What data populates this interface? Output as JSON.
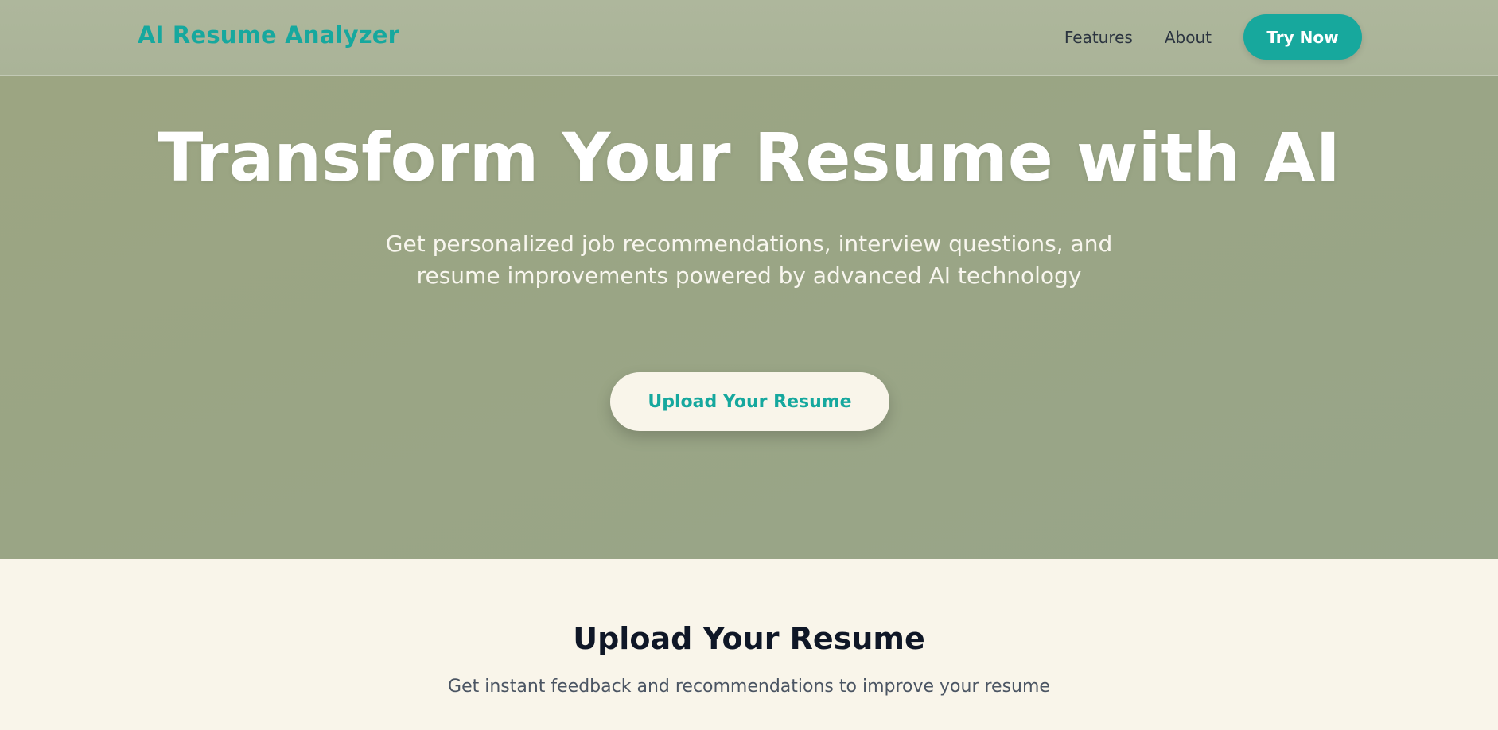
{
  "header": {
    "logo": "AI Resume Analyzer",
    "nav": {
      "features": "Features",
      "about": "About",
      "try_now": "Try Now"
    }
  },
  "hero": {
    "title": "Transform Your Resume with AI",
    "subtitle": "Get personalized job recommendations, interview questions, and resume improvements powered by advanced AI technology",
    "cta": "Upload Your Resume"
  },
  "upload_section": {
    "title": "Upload Your Resume",
    "subtitle": "Get instant feedback and recommendations to improve your resume"
  },
  "colors": {
    "accent": "#16a89e",
    "header_bg": "#aeb79c",
    "hero_bg": "#9ca582",
    "cream": "#f9f5ea",
    "dark_text": "#0f1727"
  }
}
